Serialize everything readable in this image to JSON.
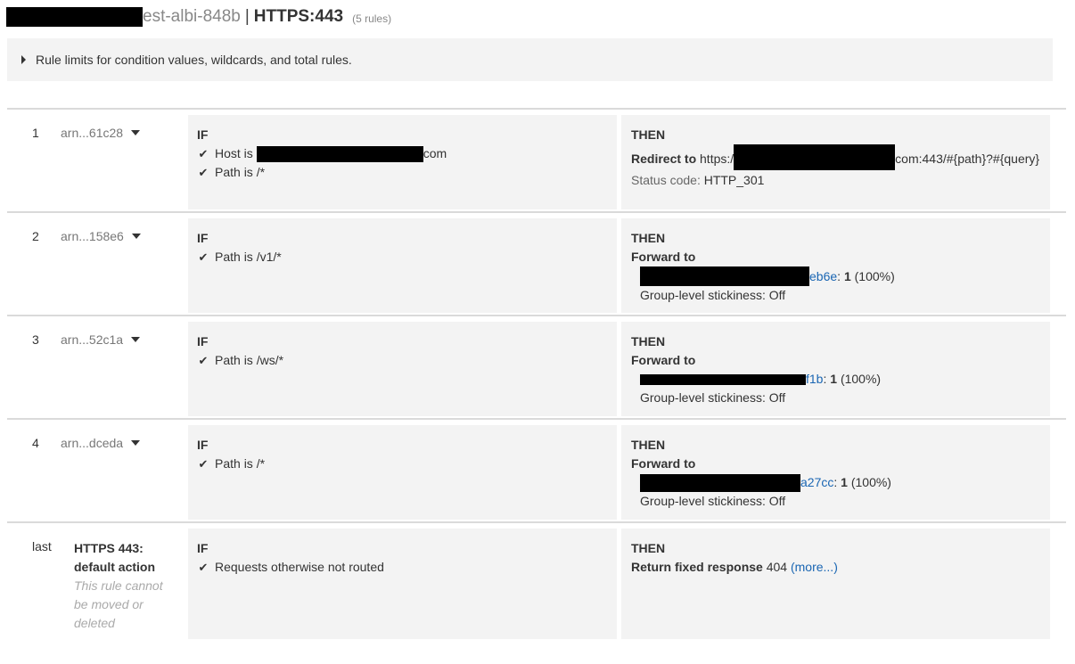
{
  "header": {
    "lb_name": "est-albi-848b",
    "separator": "|",
    "listener": "HTTPS:443",
    "rule_count": "(5 rules)"
  },
  "limits": {
    "label": "Rule limits for condition values, wildcards, and total rules."
  },
  "labels": {
    "if": "IF",
    "then": "THEN",
    "host_is": "Host is",
    "path_is": "Path is",
    "redirect_to": "Redirect to",
    "forward_to": "Forward to",
    "status_code": "Status code:",
    "stickiness": "Group-level stickiness: Off",
    "return_fixed": "Return fixed response"
  },
  "rules": [
    {
      "number": "1",
      "arn": "arn...61c28",
      "host_suffix": "com",
      "path": "/*",
      "redirect_prefix": "https:/",
      "redirect_suffix": "com:443/#{path}?#{query}",
      "status_code_value": "HTTP_301"
    },
    {
      "number": "2",
      "arn": "arn...158e6",
      "path": "/v1/*",
      "tg_suffix": "eb6e",
      "weight": "1",
      "percent": "(100%)"
    },
    {
      "number": "3",
      "arn": "arn...52c1a",
      "path": "/ws/*",
      "tg_suffix": "f1b",
      "weight": "1",
      "percent": "(100%)"
    },
    {
      "number": "4",
      "arn": "arn...dceda",
      "path": "/*",
      "tg_suffix": "a27cc",
      "weight": "1",
      "percent": "(100%)"
    }
  ],
  "default_rule": {
    "number": "last",
    "title": "HTTPS 443: default action",
    "note": "This rule cannot be moved or deleted",
    "condition": "Requests otherwise not routed",
    "status": "404",
    "more_link": "(more...)"
  },
  "colors": {
    "panel_bg": "#f3f3f3",
    "divider": "#dadada",
    "link": "#1a66b3",
    "redaction": "#000000"
  },
  "icons": {
    "check": "check-icon",
    "expand": "caret-right-icon",
    "dropdown": "caret-down-icon"
  }
}
